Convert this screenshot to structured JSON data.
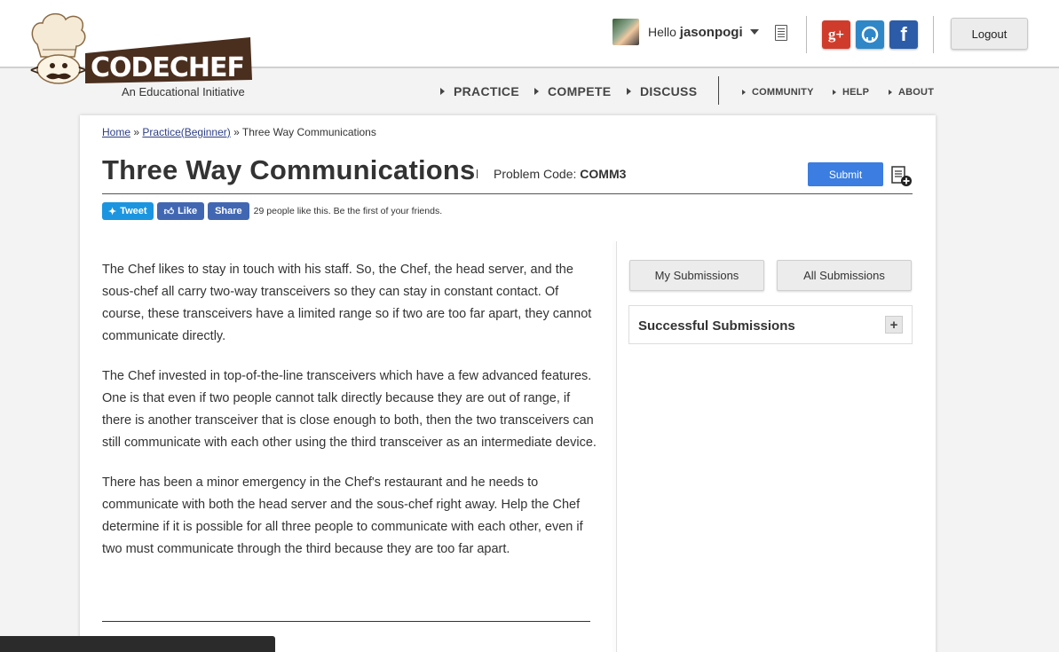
{
  "brand": {
    "name": "CODECHEF",
    "tagline": "An Educational Initiative"
  },
  "user": {
    "greeting": "Hello",
    "username": "jasonpogi"
  },
  "header": {
    "logout_label": "Logout",
    "social_icons": [
      "google-plus-icon",
      "github-icon",
      "facebook-icon"
    ]
  },
  "nav": {
    "primary": [
      "PRACTICE",
      "COMPETE",
      "DISCUSS"
    ],
    "secondary": [
      "COMMUNITY",
      "HELP",
      "ABOUT"
    ]
  },
  "breadcrumb": {
    "home": "Home",
    "sep1": "»",
    "section": "Practice(Beginner)",
    "sep2": "»",
    "current": "Three Way Communications"
  },
  "problem": {
    "title": "Three Way Communications",
    "code_label": "Problem Code:",
    "code": "COMM3",
    "submit_label": "Submit",
    "paragraphs": [
      "The Chef likes to stay in touch with his staff. So, the Chef, the head server, and the sous-chef all carry two-way transceivers so they can stay in constant contact. Of course, these transceivers have a limited range so if two are too far apart, they cannot communicate directly.",
      "The Chef invested in top-of-the-line transceivers which have a few advanced features. One is that even if two people cannot talk directly because they are out of range, if there is another transceiver that is close enough to both, then the two transceivers can still communicate with each other using the third transceiver as an intermediate device.",
      "There has been a minor emergency in the Chef's restaurant and he needs to communicate with both the head server and the sous-chef right away. Help the Chef determine if it is possible for all three people to communicate with each other, even if two must communicate through the third because they are too far apart."
    ]
  },
  "share": {
    "tweet_label": "Tweet",
    "like_label": "Like",
    "share_label": "Share",
    "likes_text": "29 people like this. Be the first of your friends."
  },
  "sidebar": {
    "my_submissions": "My Submissions",
    "all_submissions": "All Submissions",
    "successful_title": "Successful Submissions",
    "expand_symbol": "+"
  },
  "colors": {
    "accent": "#3b7de0",
    "brand_brown": "#4a2e1e",
    "google_plus": "#d03c2b",
    "github": "#2f87c8",
    "facebook": "#2c5ca8",
    "twitter": "#1b95e0"
  }
}
